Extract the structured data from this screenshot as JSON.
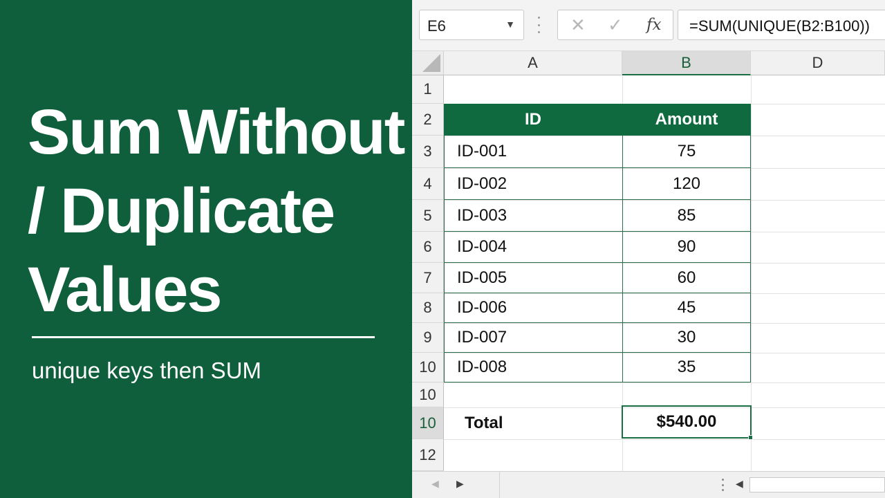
{
  "banner": {
    "title_lines": [
      "Sum Without",
      "/ Duplicate",
      "Values"
    ],
    "subtitle": "unique keys then SUM"
  },
  "formula_bar": {
    "name_box": "E6",
    "formula": "=SUM(UNIQUE(B2:B100))",
    "fx_label": "fx"
  },
  "icons": {
    "cancel": "close-icon",
    "enter": "check-icon",
    "name_box_dropdown": "chevron-down-icon"
  },
  "columns": [
    "A",
    "B",
    "D"
  ],
  "row_numbers": [
    "1",
    "2",
    "3",
    "4",
    "5",
    "6",
    "7",
    "8",
    "9",
    "10",
    "10",
    "10",
    "12"
  ],
  "table": {
    "headers": [
      "ID",
      "Amount"
    ],
    "rows": [
      {
        "id": "ID-001",
        "amount": "75"
      },
      {
        "id": "ID-002",
        "amount": "120"
      },
      {
        "id": "ID-003",
        "amount": "85"
      },
      {
        "id": "ID-004",
        "amount": "90"
      },
      {
        "id": "ID-005",
        "amount": "60"
      },
      {
        "id": "ID-006",
        "amount": "45"
      },
      {
        "id": "ID-007",
        "amount": "30"
      },
      {
        "id": "ID-008",
        "amount": "35"
      }
    ],
    "total_label": "Total",
    "total_value": "$540.00"
  },
  "colors": {
    "banner_green": "#0f5e3c",
    "header_green": "#0f6b3f",
    "selection_green": "#1a6e44"
  }
}
